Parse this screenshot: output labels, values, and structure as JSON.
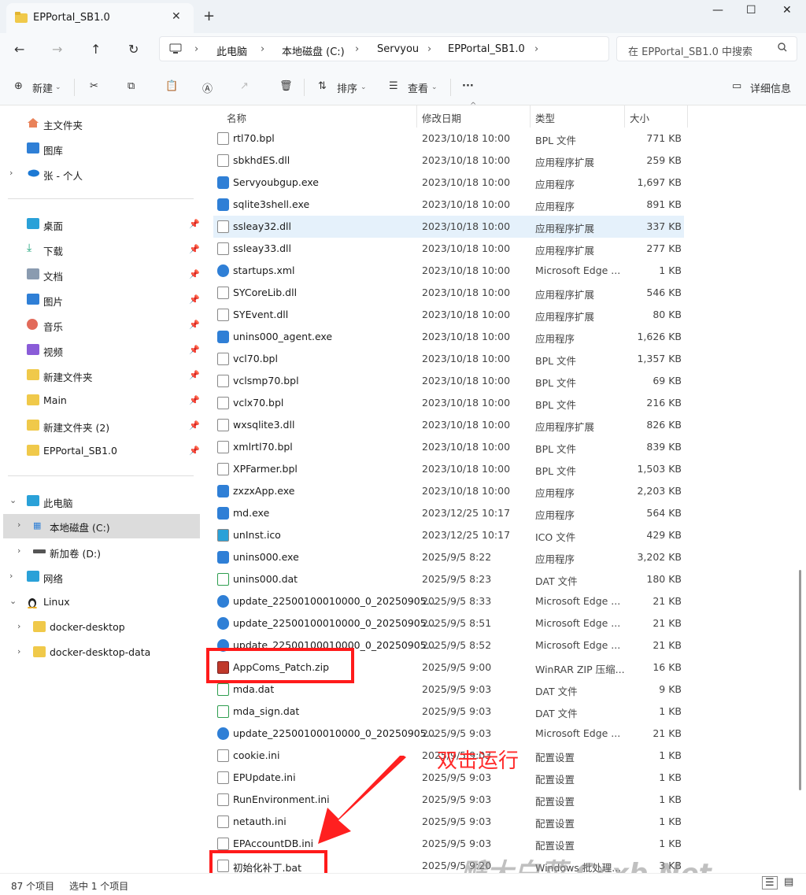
{
  "window": {
    "tab_title": "EPPortal_SB1.0",
    "new_tab": "+",
    "minimize": "—",
    "maximize": "☐",
    "close": "✕",
    "tab_close": "✕"
  },
  "nav": {
    "back": "←",
    "forward": "→",
    "up": "↑",
    "refresh": "↻",
    "breadcrumb": [
      "此电脑",
      "本地磁盘 (C:)",
      "Servyou",
      "EPPortal_SB1.0"
    ],
    "search_placeholder": "在 EPPortal_SB1.0 中搜索"
  },
  "toolbar": {
    "new": "新建",
    "sort": "排序",
    "view": "查看",
    "more": "···",
    "details": "详细信息"
  },
  "sidebar": {
    "top": [
      {
        "label": "主文件夹"
      },
      {
        "label": "图库"
      },
      {
        "label": "张 - 个人"
      }
    ],
    "quick": [
      {
        "label": "桌面"
      },
      {
        "label": "下载"
      },
      {
        "label": "文档"
      },
      {
        "label": "图片"
      },
      {
        "label": "音乐"
      },
      {
        "label": "视频"
      },
      {
        "label": "新建文件夹"
      },
      {
        "label": "Main"
      },
      {
        "label": "新建文件夹 (2)"
      },
      {
        "label": "EPPortal_SB1.0"
      }
    ],
    "tree": [
      {
        "label": "此电脑"
      },
      {
        "label": "本地磁盘 (C:)"
      },
      {
        "label": "新加卷 (D:)"
      },
      {
        "label": "网络"
      },
      {
        "label": "Linux"
      },
      {
        "label": "docker-desktop"
      },
      {
        "label": "docker-desktop-data"
      }
    ]
  },
  "columns": {
    "name": "名称",
    "date": "修改日期",
    "type": "类型",
    "size": "大小"
  },
  "files": [
    {
      "name": "rtl70.bpl",
      "date": "2023/10/18 10:00",
      "type": "BPL 文件",
      "size": "771 KB"
    },
    {
      "name": "sbkhdES.dll",
      "date": "2023/10/18 10:00",
      "type": "应用程序扩展",
      "size": "259 KB"
    },
    {
      "name": "Servyoubgup.exe",
      "date": "2023/10/18 10:00",
      "type": "应用程序",
      "size": "1,697 KB"
    },
    {
      "name": "sqlite3shell.exe",
      "date": "2023/10/18 10:00",
      "type": "应用程序",
      "size": "891 KB"
    },
    {
      "name": "ssleay32.dll",
      "date": "2023/10/18 10:00",
      "type": "应用程序扩展",
      "size": "337 KB"
    },
    {
      "name": "ssleay33.dll",
      "date": "2023/10/18 10:00",
      "type": "应用程序扩展",
      "size": "277 KB"
    },
    {
      "name": "startups.xml",
      "date": "2023/10/18 10:00",
      "type": "Microsoft Edge ...",
      "size": "1 KB"
    },
    {
      "name": "SYCoreLib.dll",
      "date": "2023/10/18 10:00",
      "type": "应用程序扩展",
      "size": "546 KB"
    },
    {
      "name": "SYEvent.dll",
      "date": "2023/10/18 10:00",
      "type": "应用程序扩展",
      "size": "80 KB"
    },
    {
      "name": "unins000_agent.exe",
      "date": "2023/10/18 10:00",
      "type": "应用程序",
      "size": "1,626 KB"
    },
    {
      "name": "vcl70.bpl",
      "date": "2023/10/18 10:00",
      "type": "BPL 文件",
      "size": "1,357 KB"
    },
    {
      "name": "vclsmp70.bpl",
      "date": "2023/10/18 10:00",
      "type": "BPL 文件",
      "size": "69 KB"
    },
    {
      "name": "vclx70.bpl",
      "date": "2023/10/18 10:00",
      "type": "BPL 文件",
      "size": "216 KB"
    },
    {
      "name": "wxsqlite3.dll",
      "date": "2023/10/18 10:00",
      "type": "应用程序扩展",
      "size": "826 KB"
    },
    {
      "name": "xmlrtl70.bpl",
      "date": "2023/10/18 10:00",
      "type": "BPL 文件",
      "size": "839 KB"
    },
    {
      "name": "XPFarmer.bpl",
      "date": "2023/10/18 10:00",
      "type": "BPL 文件",
      "size": "1,503 KB"
    },
    {
      "name": "zxzxApp.exe",
      "date": "2023/10/18 10:00",
      "type": "应用程序",
      "size": "2,203 KB"
    },
    {
      "name": "md.exe",
      "date": "2023/12/25 10:17",
      "type": "应用程序",
      "size": "564 KB"
    },
    {
      "name": "unInst.ico",
      "date": "2023/12/25 10:17",
      "type": "ICO 文件",
      "size": "429 KB"
    },
    {
      "name": "unins000.exe",
      "date": "2025/9/5 8:22",
      "type": "应用程序",
      "size": "3,202 KB"
    },
    {
      "name": "unins000.dat",
      "date": "2025/9/5 8:23",
      "type": "DAT 文件",
      "size": "180 KB"
    },
    {
      "name": "update_22500100010000_0_20250905...",
      "date": "2025/9/5 8:33",
      "type": "Microsoft Edge ...",
      "size": "21 KB"
    },
    {
      "name": "update_22500100010000_0_20250905...",
      "date": "2025/9/5 8:51",
      "type": "Microsoft Edge ...",
      "size": "21 KB"
    },
    {
      "name": "update_22500100010000_0_20250905...",
      "date": "2025/9/5 8:52",
      "type": "Microsoft Edge ...",
      "size": "21 KB"
    },
    {
      "name": "AppComs_Patch.zip",
      "date": "2025/9/5 9:00",
      "type": "WinRAR ZIP 压缩...",
      "size": "16 KB"
    },
    {
      "name": "mda.dat",
      "date": "2025/9/5 9:03",
      "type": "DAT 文件",
      "size": "9 KB"
    },
    {
      "name": "mda_sign.dat",
      "date": "2025/9/5 9:03",
      "type": "DAT 文件",
      "size": "1 KB"
    },
    {
      "name": "update_22500100010000_0_20250905...",
      "date": "2025/9/5 9:03",
      "type": "Microsoft Edge ...",
      "size": "21 KB"
    },
    {
      "name": "cookie.ini",
      "date": "2025/9/5 9:03",
      "type": "配置设置",
      "size": "1 KB"
    },
    {
      "name": "EPUpdate.ini",
      "date": "2025/9/5 9:03",
      "type": "配置设置",
      "size": "1 KB"
    },
    {
      "name": "RunEnvironment.ini",
      "date": "2025/9/5 9:03",
      "type": "配置设置",
      "size": "1 KB"
    },
    {
      "name": "netauth.ini",
      "date": "2025/9/5 9:03",
      "type": "配置设置",
      "size": "1 KB"
    },
    {
      "name": "EPAccountDB.ini",
      "date": "2025/9/5 9:03",
      "type": "配置设置",
      "size": "1 KB"
    },
    {
      "name": "初始化补丁.bat",
      "date": "2025/9/5 9:20",
      "type": "Windows 批处理...",
      "size": "3 KB"
    }
  ],
  "annotation": "双击运行",
  "watermark": "飕大白菜 Ccxb.Net",
  "status": {
    "count": "87 个项目",
    "selected": "选中 1 个项目"
  },
  "colors": {
    "highlight": "#ff1b1b",
    "selected_row": "#e5f1fb",
    "folder": "#f0c94a"
  }
}
